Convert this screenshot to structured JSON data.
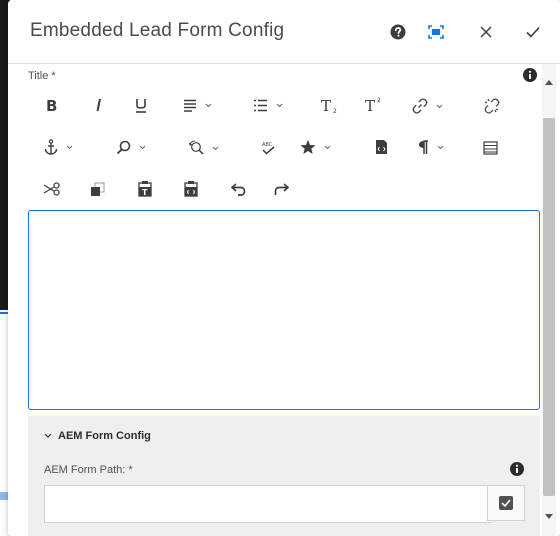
{
  "dialog": {
    "title": "Embedded Lead Form Config",
    "header_buttons": [
      "help-icon",
      "fullscreen-icon",
      "close-icon",
      "done-check-icon"
    ]
  },
  "field": {
    "label": "Title *",
    "editor_content": ""
  },
  "toolbar": {
    "row1": [
      "bold",
      "italic",
      "underline",
      "justify-dropdown",
      "list-dropdown",
      "subscript",
      "superscript",
      "link-dropdown",
      "unlink"
    ],
    "row2": [
      "anchor-dropdown",
      "find-dropdown",
      "find-replace-dropdown",
      "spellcheck",
      "special-characters-dropdown",
      "source-edit",
      "paragraph-format-dropdown",
      "table"
    ],
    "row3": [
      "cut",
      "copy",
      "paste-as-text",
      "paste-from-word",
      "undo",
      "redo"
    ]
  },
  "section": {
    "title": "AEM Form Config",
    "path_label": "AEM Form Path: *",
    "path_value": ""
  },
  "colors": {
    "accent": "#1473e6",
    "icon": "#3d3d3d",
    "section_bg": "#efefef"
  }
}
